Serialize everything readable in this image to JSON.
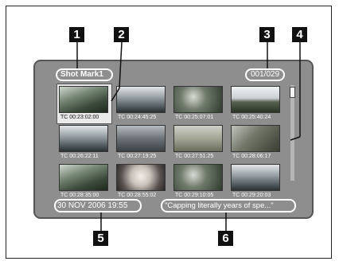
{
  "callouts": [
    "1",
    "2",
    "3",
    "4",
    "5",
    "6"
  ],
  "shot_mark": "Shot Mark1",
  "clip_counter": "001/029",
  "thumbnails": [
    {
      "tc": "TC 00:23:02:00",
      "scene": "forest",
      "selected": true
    },
    {
      "tc": "TC 00:24:45:25",
      "scene": "river"
    },
    {
      "tc": "TC 00:25:07:01",
      "scene": "foliage"
    },
    {
      "tc": "TC 00:25:40:24",
      "scene": "landscape"
    },
    {
      "tc": "TC 00:26:22:11",
      "scene": "river"
    },
    {
      "tc": "TC 00:27:19:25",
      "scene": "city"
    },
    {
      "tc": "TC 00:27:51:25",
      "scene": "field"
    },
    {
      "tc": "TC 00:28:06:17",
      "scene": "rock"
    },
    {
      "tc": "TC 00:28:35:00",
      "scene": "forest"
    },
    {
      "tc": "TC 00:28:55:02",
      "scene": "portrait"
    },
    {
      "tc": "TC 00:29:10:05",
      "scene": "foliage"
    },
    {
      "tc": "TC 00:29:20:03",
      "scene": "river"
    }
  ],
  "date_time": "30 NOV   2006 19:55",
  "memo": "\"Capping literally years of spe...\""
}
